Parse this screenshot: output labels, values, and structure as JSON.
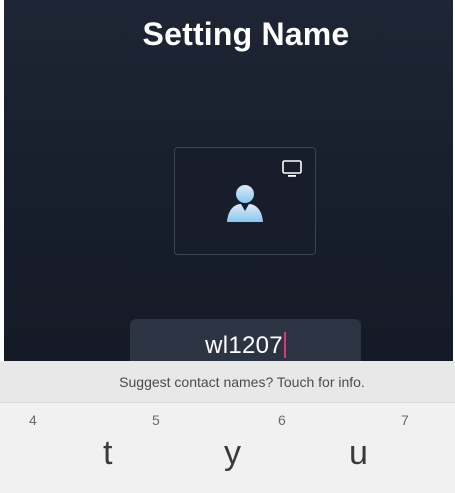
{
  "screen": {
    "title": "Setting Name"
  },
  "profile": {
    "avatar_icon": "person-avatar-icon",
    "device_icon": "monitor-icon"
  },
  "name_input": {
    "value": "wl1207"
  },
  "keyboard": {
    "suggestion_text": "Suggest contact names? Touch for info.",
    "keys": [
      {
        "hint": "4",
        "letter": ""
      },
      {
        "hint": "5",
        "letter": "t"
      },
      {
        "hint": "6",
        "letter": "y"
      },
      {
        "hint": "7",
        "letter": "u"
      }
    ]
  },
  "colors": {
    "background": "#1B2230",
    "title": "#FFFFFF",
    "field_background": "#2C3443",
    "cursor": "#D83C6A",
    "keyboard_background": "#F1F1F1",
    "suggestion_background": "#E8E8E8"
  }
}
